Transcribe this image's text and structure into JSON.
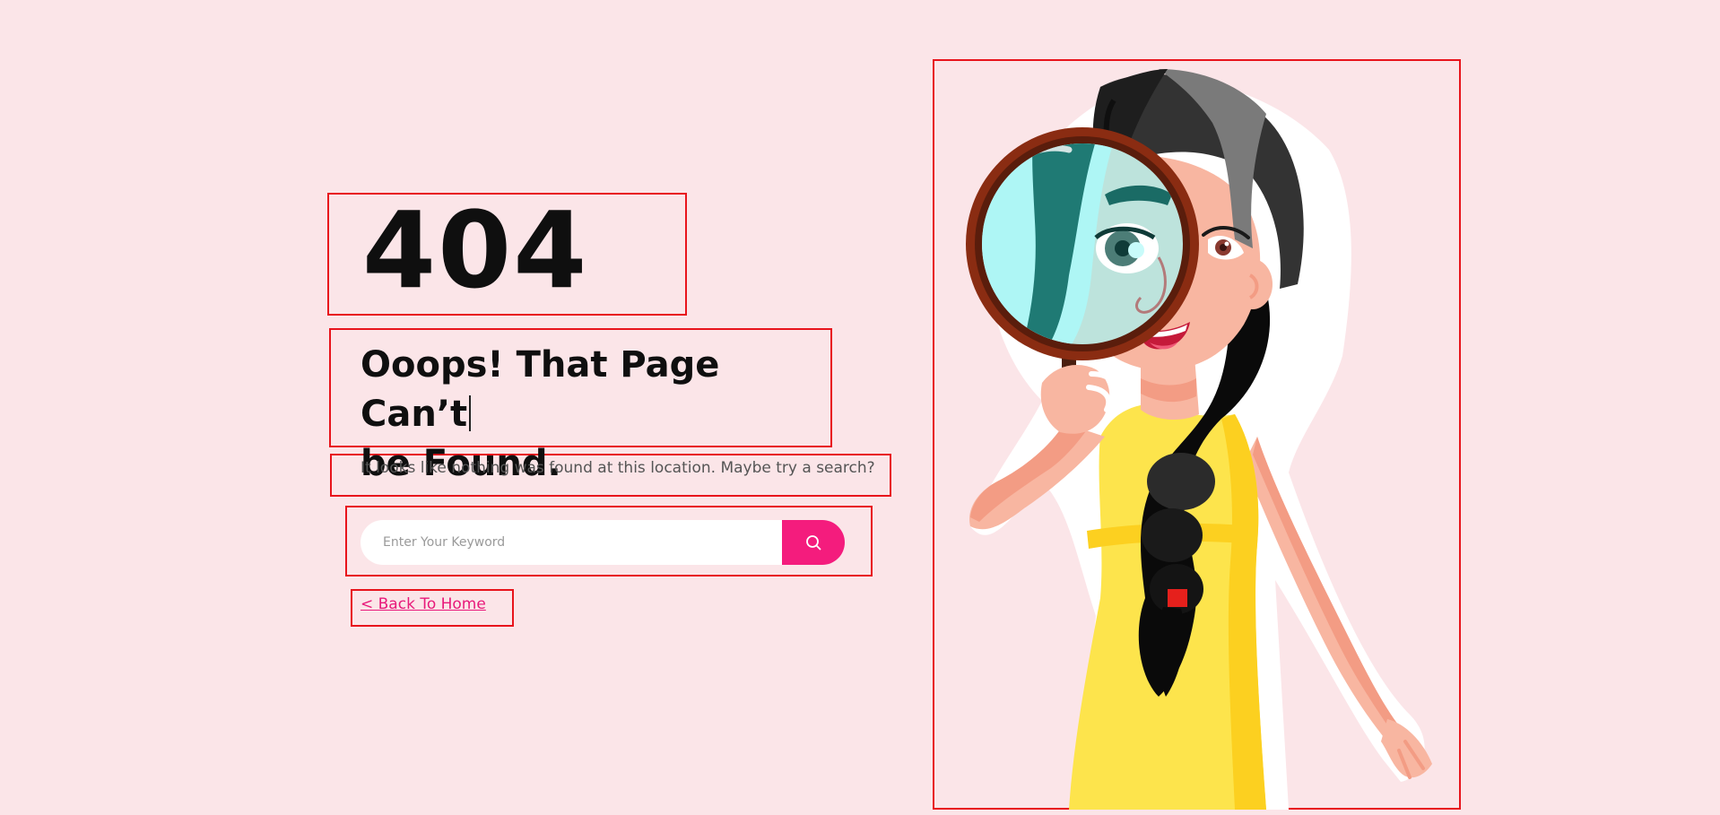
{
  "error": {
    "code": "404",
    "title_line1": "Ooops! That Page Can’t",
    "title_line2": "be Found.",
    "description": "It looks like nothing was found at this location. Maybe try a search?"
  },
  "search": {
    "placeholder": "Enter Your Keyword",
    "value": "",
    "button_icon": "search-icon"
  },
  "navigation": {
    "back_link": "< Back To Home"
  },
  "colors": {
    "page_background": "#fbe5e8",
    "accent": "#f41c7d",
    "link": "#e8197a",
    "annotation_box": "#e8141c"
  }
}
